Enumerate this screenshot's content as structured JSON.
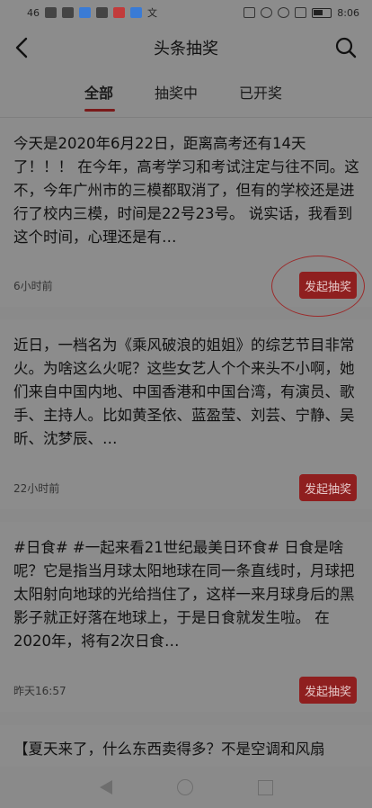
{
  "status_bar": {
    "signal": "46",
    "time": "8:06",
    "text_icon": "文"
  },
  "header": {
    "title": "头条抽奖",
    "back_icon": "chevron-left-icon",
    "search_icon": "search-icon"
  },
  "tabs": [
    {
      "label": "全部",
      "active": true
    },
    {
      "label": "抽奖中",
      "active": false
    },
    {
      "label": "已开奖",
      "active": false
    }
  ],
  "cards": [
    {
      "text": "今天是2020年6月22日，距离高考还有14天了！！！ 在今年，高考学习和考试注定与往不同。这不，今年广州市的三模都取消了，但有的学校还是进行了校内三模，时间是22号23号。 说实话，我看到这个时间，心理还是有…",
      "time": "6小时前",
      "button": "发起抽奖"
    },
    {
      "text": "近日，一档名为《乘风破浪的姐姐》的综艺节目非常火。为啥这么火呢？这些女艺人个个来头不小啊，她们来自中国内地、中国香港和中国台湾，有演员、歌手、主持人。比如黄圣依、蓝盈莹、刘芸、宁静、吴昕、沈梦辰、…",
      "time": "22小时前",
      "button": "发起抽奖"
    },
    {
      "text": "#日食# #一起来看21世纪最美日环食# 日食是啥呢？它是指当月球太阳地球在同一条直线时，月球把太阳射向地球的光给挡住了，这样一来月球身后的黑影子就正好落在地球上，于是日食就发生啦。 在2020年，将有2次日食…",
      "time": "昨天16:57",
      "button": "发起抽奖"
    },
    {
      "text": "【夏天来了，什么东西卖得多？不是空调和风扇",
      "time": "",
      "button": ""
    }
  ],
  "colors": {
    "overlay_bg": "#8c8c8c",
    "accent": "#8f1f1f"
  }
}
